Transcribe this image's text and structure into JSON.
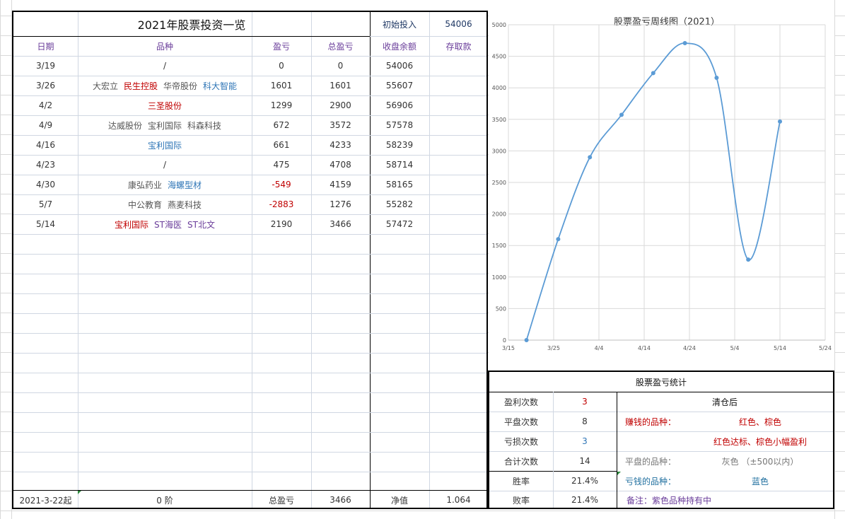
{
  "title": "2021年股票投资一览",
  "initial": {
    "label": "初始投入",
    "value": "54006"
  },
  "headers": {
    "date": "日期",
    "stock": "品种",
    "pnl": "盈亏",
    "total": "总盈亏",
    "balance": "收盘余额",
    "deposit": "存取款"
  },
  "rows": [
    {
      "date": "3/19",
      "stocks": [
        {
          "text": "/",
          "color": "#333333"
        }
      ],
      "pnl": "0",
      "pnl_color": "#333333",
      "total": "0",
      "balance": "54006"
    },
    {
      "date": "3/26",
      "stocks": [
        {
          "text": "大宏立",
          "color": "#555555"
        },
        {
          "text": "民生控股",
          "color": "#c00000"
        },
        {
          "text": "华帝股份",
          "color": "#555555"
        },
        {
          "text": "科大智能",
          "color": "#2e75b6"
        }
      ],
      "pnl": "1601",
      "pnl_color": "#333333",
      "total": "1601",
      "balance": "55607"
    },
    {
      "date": "4/2",
      "stocks": [
        {
          "text": "三圣股份",
          "color": "#c00000"
        }
      ],
      "pnl": "1299",
      "pnl_color": "#333333",
      "total": "2900",
      "balance": "56906"
    },
    {
      "date": "4/9",
      "stocks": [
        {
          "text": "达威股份",
          "color": "#555555"
        },
        {
          "text": "宝利国际",
          "color": "#555555"
        },
        {
          "text": "科森科技",
          "color": "#555555"
        }
      ],
      "pnl": "672",
      "pnl_color": "#333333",
      "total": "3572",
      "balance": "57578"
    },
    {
      "date": "4/16",
      "stocks": [
        {
          "text": "宝利国际",
          "color": "#2e75b6"
        }
      ],
      "pnl": "661",
      "pnl_color": "#333333",
      "total": "4233",
      "balance": "58239"
    },
    {
      "date": "4/23",
      "stocks": [
        {
          "text": "/",
          "color": "#333333"
        }
      ],
      "pnl": "475",
      "pnl_color": "#333333",
      "total": "4708",
      "balance": "58714"
    },
    {
      "date": "4/30",
      "stocks": [
        {
          "text": "康弘药业",
          "color": "#555555"
        },
        {
          "text": "海螺型材",
          "color": "#2e75b6"
        }
      ],
      "pnl": "-549",
      "pnl_color": "#c00000",
      "total": "4159",
      "balance": "58165"
    },
    {
      "date": "5/7",
      "stocks": [
        {
          "text": "中公教育",
          "color": "#555555"
        },
        {
          "text": "燕麦科技",
          "color": "#555555"
        }
      ],
      "pnl": "-2883",
      "pnl_color": "#c00000",
      "total": "1276",
      "balance": "55282"
    },
    {
      "date": "5/14",
      "stocks": [
        {
          "text": "宝利国际",
          "color": "#c00000"
        },
        {
          "text": "ST海医",
          "color": "#6a3d9a"
        },
        {
          "text": "ST北文",
          "color": "#6a3d9a"
        }
      ],
      "pnl": "2190",
      "pnl_color": "#333333",
      "total": "3466",
      "balance": "57472"
    }
  ],
  "footer": {
    "start": "2021-3-22起",
    "level": "0 阶",
    "total_label": "总盈亏",
    "total_value": "3466",
    "net_label": "净值",
    "net_value": "1.064"
  },
  "chart_data": {
    "type": "line",
    "title": "股票盈亏周线图（2021）",
    "x": [
      "2021-03-19",
      "2021-03-26",
      "2021-04-02",
      "2021-04-09",
      "2021-04-16",
      "2021-04-23",
      "2021-04-30",
      "2021-05-07",
      "2021-05-14"
    ],
    "values": [
      0,
      1601,
      2900,
      3572,
      4233,
      4708,
      4159,
      1276,
      3466
    ],
    "x_ticks": [
      "3/15",
      "3/25",
      "4/4",
      "4/14",
      "4/24",
      "5/4",
      "5/14",
      "5/24"
    ],
    "x_tick_dates": [
      "2021-03-15",
      "2021-03-25",
      "2021-04-04",
      "2021-04-14",
      "2021-04-24",
      "2021-05-04",
      "2021-05-14",
      "2021-05-24"
    ],
    "y_ticks": [
      "0",
      "500",
      "1000",
      "1500",
      "2000",
      "2500",
      "3000",
      "3500",
      "4000",
      "4500",
      "5000"
    ],
    "ylim": [
      0,
      5000
    ],
    "grid": true,
    "line_color": "#5b9bd5"
  },
  "stats": {
    "title": "股票盈亏统计",
    "labels": {
      "win": "盈利次数",
      "flat": "平盘次数",
      "loss": "亏损次数",
      "total": "合计次数",
      "win_rate": "胜率",
      "loss_rate": "败率"
    },
    "values": {
      "win": "3",
      "flat": "8",
      "loss": "3",
      "total": "14",
      "win_rate": "21.4%",
      "loss_rate": "21.4%"
    },
    "legend_title": "清仓后",
    "earn_label": "赚钱的品种：",
    "earn_value": "红色、棕色",
    "earn_value2": "红色达标、棕色小幅盈利",
    "flat_label": "平盘的品种：",
    "flat_value": "灰色 （±500以内）",
    "lose_label": "亏钱的品种：",
    "lose_value": "蓝色",
    "note": "备注：紫色品种持有中"
  }
}
